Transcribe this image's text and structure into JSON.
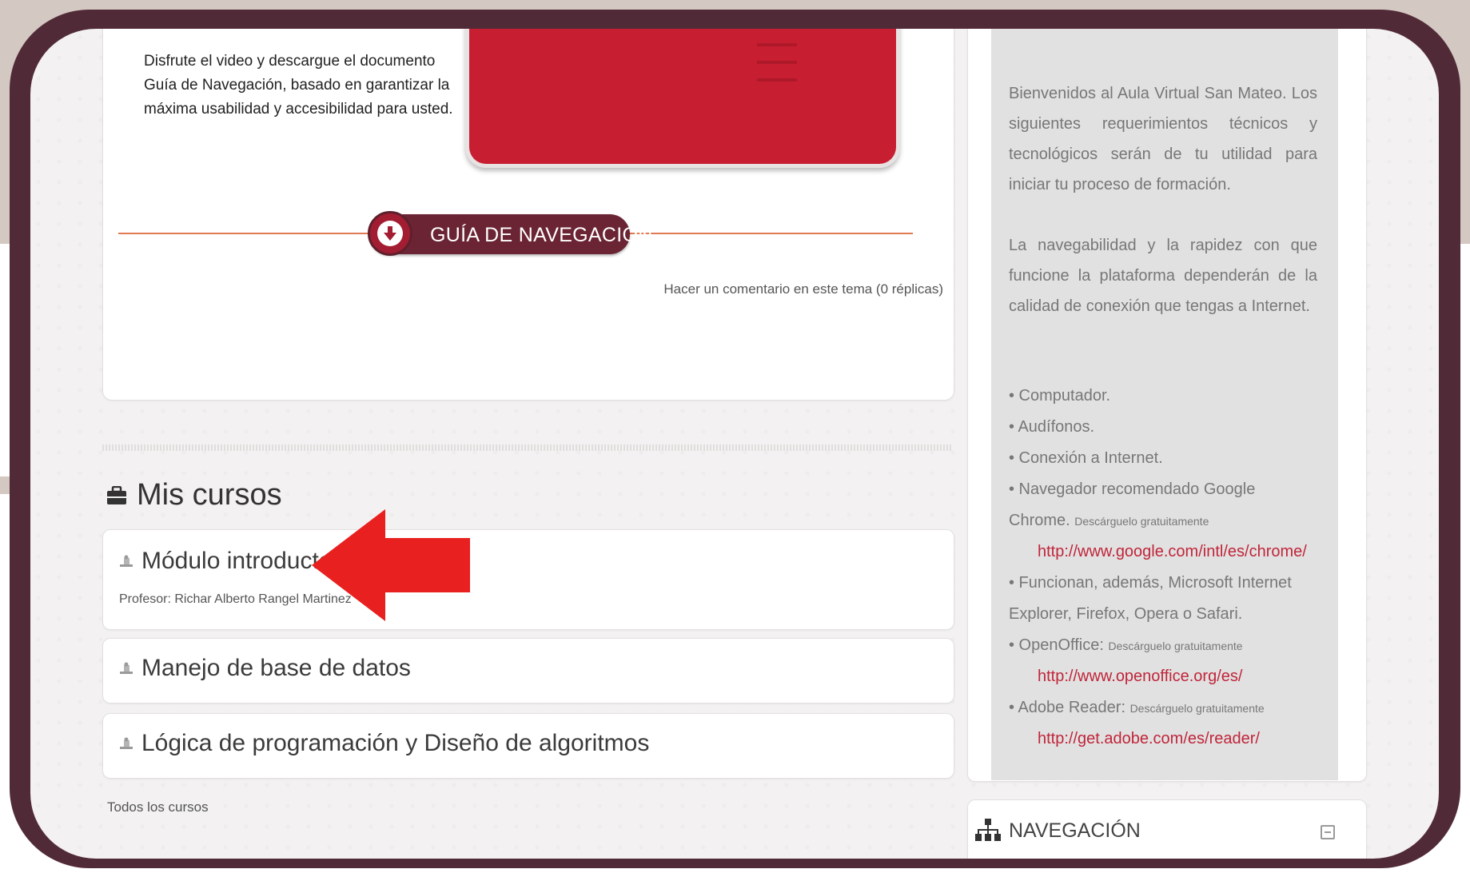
{
  "intro": {
    "text": "Disfrute el video y descargue el documento Guía de Navegación, basado en garantizar la máxima usabilidad y accesibilidad para usted."
  },
  "guide": {
    "label": "GUÍA DE NAVEGACIÓN",
    "icon": "download-circle-icon"
  },
  "comment_link": "Hacer un comentario en este tema (0 réplicas)",
  "my_courses": {
    "title": "Mis cursos",
    "icon": "briefcase-icon",
    "courses": [
      {
        "name": "Módulo introductorio",
        "teacher": "Profesor: Richar Alberto Rangel Martinez"
      },
      {
        "name": "Manejo de base de datos"
      },
      {
        "name": "Lógica de programación y Diseño de algoritmos"
      }
    ],
    "all_courses": "Todos los cursos"
  },
  "sidebar": {
    "intro_p1": "Bienvenidos al Aula Virtual San Mateo. Los siguientes requerimientos técnicos y tecnológicos serán de tu utilidad para iniciar tu proceso de formación.",
    "intro_p2": "La navegabilidad y la rapidez con que funcione la plataforma dependerán de la calidad de conexión que tengas a Internet.",
    "req_1": "• Computador.",
    "req_2": "• Audífonos.",
    "req_3": "• Conexión a Internet.",
    "req_4a": "• Navegador recomendado Google",
    "req_4b": "Chrome.",
    "req_4_note": "Descárguelo gratuitamente",
    "req_4_link": "http://www.google.com/intl/es/chrome/",
    "req_5a": "• Funcionan, además, Microsoft Internet",
    "req_5b": "Explorer, Firefox, Opera o Safari.",
    "req_6": "• OpenOffice:",
    "req_6_note": "Descárguelo gratuitamente",
    "req_6_link": "http://www.openoffice.org/es/",
    "req_7": "• Adobe Reader:",
    "req_7_note": "Descárguelo gratuitamente",
    "req_7_link": "http://get.adobe.com/es/reader/"
  },
  "navigation": {
    "title": "NAVEGACIÓN",
    "icon": "sitemap-icon",
    "toggle_icon": "collapse-icon"
  },
  "colors": {
    "frame": "#512a38",
    "accent_red": "#c81e31",
    "guide_button": "#6b2433",
    "link": "#c0263a",
    "arrow": "#e8201f"
  }
}
